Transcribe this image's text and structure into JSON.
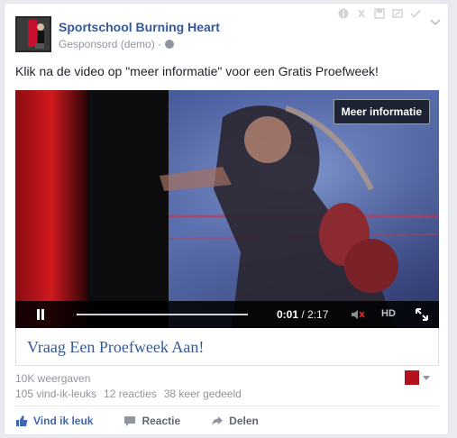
{
  "post": {
    "page_name": "Sportschool Burning Heart",
    "sponsored_label": "Gesponsord (demo) ·",
    "text": "Klik na de video op \"meer informatie\" voor een Gratis Proefweek!"
  },
  "video": {
    "more_info_label": "Meer informatie",
    "current_time": "0:01",
    "duration": "/ 2:17",
    "hd_label": "HD",
    "progress_fraction": 0.01
  },
  "cta": {
    "text": "Vraag Een Proefweek Aan!"
  },
  "stats": {
    "views": "10K weergaven",
    "likes": "105 vind-ik-leuks",
    "comments": "12 reacties",
    "shares": "38 keer gedeeld"
  },
  "actions": {
    "like": "Vind ik leuk",
    "comment": "Reactie",
    "share": "Delen"
  },
  "colors": {
    "link_blue": "#365899",
    "action_blue": "#4267b2",
    "meta_gray": "#90949c"
  },
  "icons": [
    "info-icon",
    "x-icon",
    "save-icon",
    "hide-icon",
    "check-icon",
    "chevron-down-icon",
    "globe-icon",
    "pause-icon",
    "mute-icon",
    "fullscreen-icon",
    "thumbs-up-icon",
    "comment-icon",
    "share-icon"
  ]
}
